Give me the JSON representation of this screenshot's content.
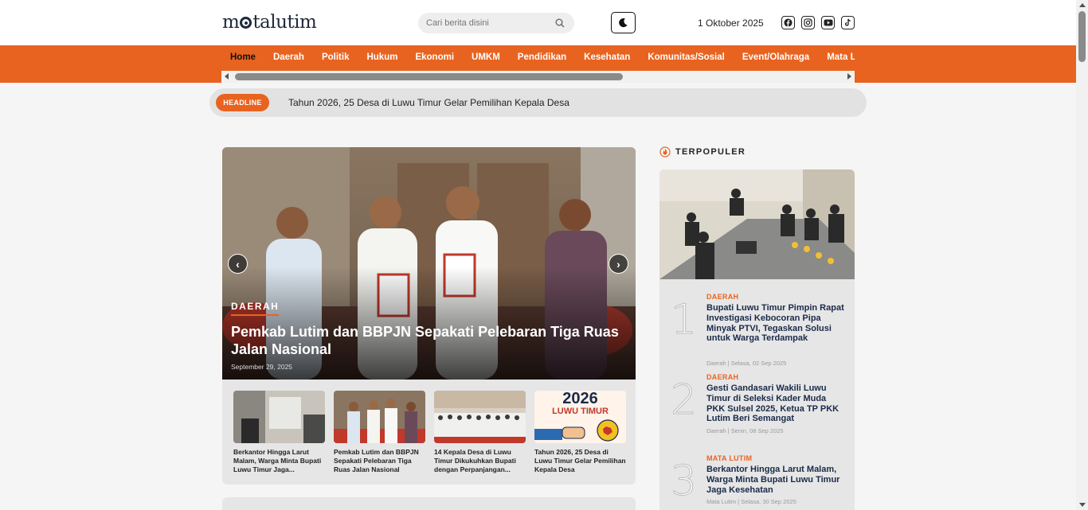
{
  "header": {
    "logo": {
      "pre": "m",
      "post": "talutim"
    },
    "search": {
      "placeholder": "Cari berita disini",
      "icon": "search-icon"
    },
    "theme_toggle_icon": "moon-icon",
    "date": "1 Oktober 2025",
    "socials": [
      "facebook-icon",
      "instagram-icon",
      "youtube-icon",
      "tiktok-icon"
    ]
  },
  "nav": {
    "items": [
      "Home",
      "Daerah",
      "Politik",
      "Hukum",
      "Ekonomi",
      "UMKM",
      "Pendidikan",
      "Kesehatan",
      "Komunitas/Sosial",
      "Event/Olahraga",
      "Mata Luwu Ray"
    ],
    "active": "Home"
  },
  "headline": {
    "label": "HEADLINE",
    "text": "Tahun 2026, 25 Desa di Luwu Timur Gelar Pemilihan Kepala Desa"
  },
  "featured": {
    "category": "DAERAH",
    "title": "Pemkab Lutim dan BBPJN Sepakati Pelebaran Tiga Ruas Jalan Nasional",
    "date": "September 29, 2025"
  },
  "thumbnails": [
    {
      "caption": "Berkantor Hingga Larut Malam, Warga Minta Bupati Luwu Timur Jaga..."
    },
    {
      "caption": "Pemkab Lutim dan BBPJN Sepakati Pelebaran Tiga Ruas Jalan Nasional"
    },
    {
      "caption": "14 Kepala Desa di Luwu Timur Dikukuhkan Bupati dengan Perpanjangan..."
    },
    {
      "caption": "Tahun 2026, 25 Desa di Luwu Timur Gelar Pemilihan Kepala Desa",
      "image_text": {
        "year": "2026",
        "place": "LUWU TIMUR"
      }
    }
  ],
  "sidebar": {
    "title": "TERPOPULER",
    "items": [
      {
        "num": "1",
        "category": "DAERAH",
        "title": "Bupati Luwu Timur Pimpin Rapat Investigasi Kebocoran Pipa Minyak PTVI, Tegaskan Solusi untuk Warga Terdampak",
        "meta": "Daerah | Selasa, 02 Sep 2025"
      },
      {
        "num": "2",
        "category": "DAERAH",
        "title": "Gesti Gandasari Wakili Luwu Timur di Seleksi Kader Muda PKK Sulsel 2025, Ketua TP PKK Lutim Beri Semangat",
        "meta": "Daerah | Senin, 08 Sep 2025"
      },
      {
        "num": "3",
        "category": "MATA LUTIM",
        "title": "Berkantor Hingga Larut Malam, Warga Minta Bupati Luwu Timur Jaga Kesehatan",
        "meta": "Mata Lutim | Selasa, 30 Sep 2025"
      }
    ]
  },
  "colors": {
    "accent": "#e8631f",
    "navy": "#1a2a4a"
  }
}
